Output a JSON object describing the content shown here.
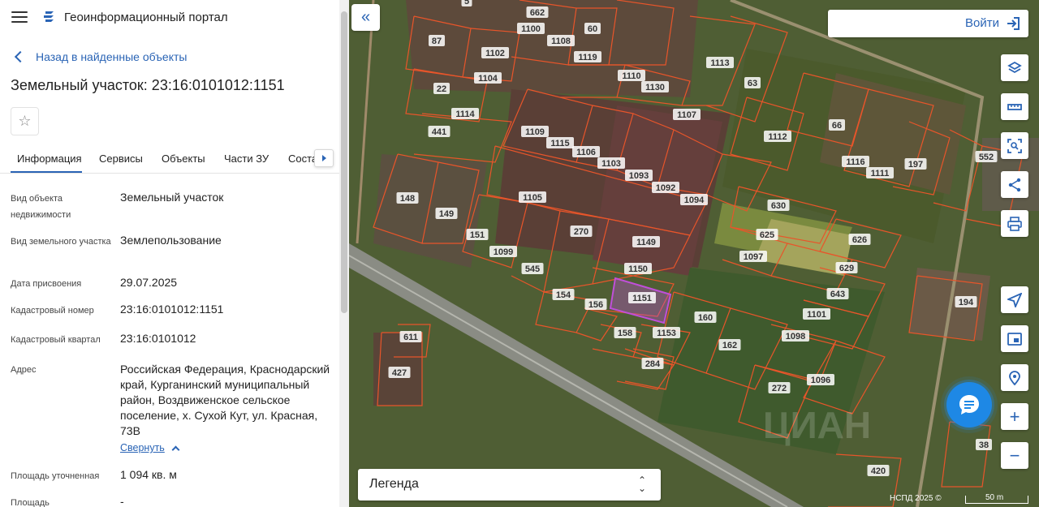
{
  "app": {
    "title": "Геоинформационный портал",
    "back_label": "Назад в найденные объекты",
    "object_title": "Земельный участок: 23:16:0101012:1151"
  },
  "tabs": [
    {
      "label": "Информация",
      "active": true
    },
    {
      "label": "Сервисы",
      "active": false
    },
    {
      "label": "Объекты",
      "active": false
    },
    {
      "label": "Части ЗУ",
      "active": false
    },
    {
      "label": "Соста",
      "active": false
    }
  ],
  "info": [
    {
      "label": "Вид объекта недвижимости",
      "value": "Земельный участок"
    },
    {
      "label": "Вид земельного участка",
      "value": "Землепользование"
    },
    {
      "label": "Дата присвоения",
      "value": "29.07.2025"
    },
    {
      "label": "Кадастровый номер",
      "value": "23:16:0101012:1151"
    },
    {
      "label": "Кадастровый квартал",
      "value": "23:16:0101012"
    },
    {
      "label": "Адрес",
      "value": "Российская Федерация, Краснодарский край, Курганинский муниципальный район, Воздвиженское сельское поселение, х. Сухой Кут, ул. Красная, 73В"
    },
    {
      "label": "Площадь уточненная",
      "value": "1 094 кв. м"
    },
    {
      "label": "Площадь",
      "value": "-"
    }
  ],
  "collapse_label": "Свернуть",
  "map": {
    "login_label": "Войти",
    "legend_label": "Легенда",
    "copyright": "НСПД 2025 ©",
    "scale_label": "50 m",
    "selected_plot": "1151",
    "plot_line_color": "#e8552a",
    "selected_color": "#c04fd9",
    "plot_labels": [
      "5",
      "662",
      "60",
      "1100",
      "1108",
      "87",
      "1102",
      "1119",
      "1104",
      "1110",
      "1130",
      "22",
      "1113",
      "63",
      "1114",
      "441",
      "1107",
      "1109",
      "1115",
      "1106",
      "1103",
      "1093",
      "1112",
      "66",
      "1116",
      "1111",
      "197",
      "552",
      "148",
      "149",
      "1105",
      "1092",
      "1094",
      "630",
      "151",
      "270",
      "625",
      "626",
      "1099",
      "1149",
      "1097",
      "629",
      "545",
      "1150",
      "643",
      "154",
      "156",
      "1151",
      "194",
      "158",
      "1153",
      "160",
      "1101",
      "162",
      "1098",
      "611",
      "284",
      "427",
      "272",
      "1096",
      "38",
      "420"
    ],
    "watermark": "ЦИАН"
  },
  "icons": {
    "menu": "menu-icon",
    "logo": "portal-logo-icon",
    "star": "star-icon",
    "layers": "layers-icon",
    "ruler": "ruler-icon",
    "select": "select-area-icon",
    "share": "share-icon",
    "print": "print-icon",
    "locate": "locate-icon",
    "minimap": "minimap-icon",
    "geo": "geo-search-icon",
    "chat": "chat-icon"
  }
}
